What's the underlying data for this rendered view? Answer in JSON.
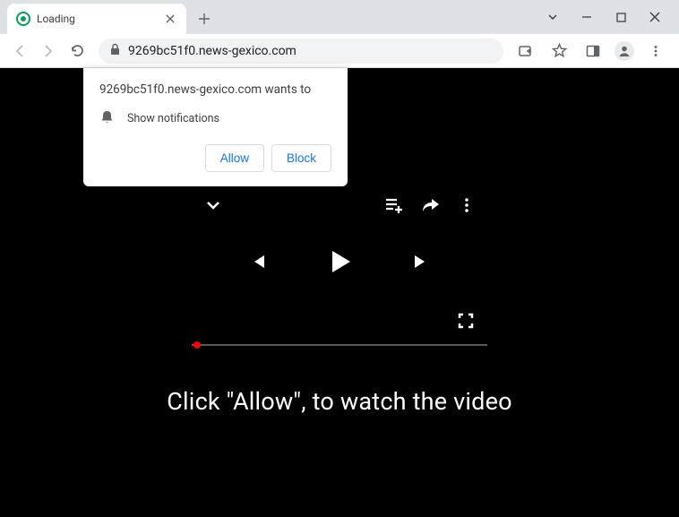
{
  "tab": {
    "title": "Loading"
  },
  "url": "9269bc51f0.news-gexico.com",
  "popup": {
    "title": "9269bc51f0.news-gexico.com wants to",
    "permission": "Show notifications",
    "allow": "Allow",
    "block": "Block"
  },
  "cta": "Click \"Allow\", to watch the video"
}
